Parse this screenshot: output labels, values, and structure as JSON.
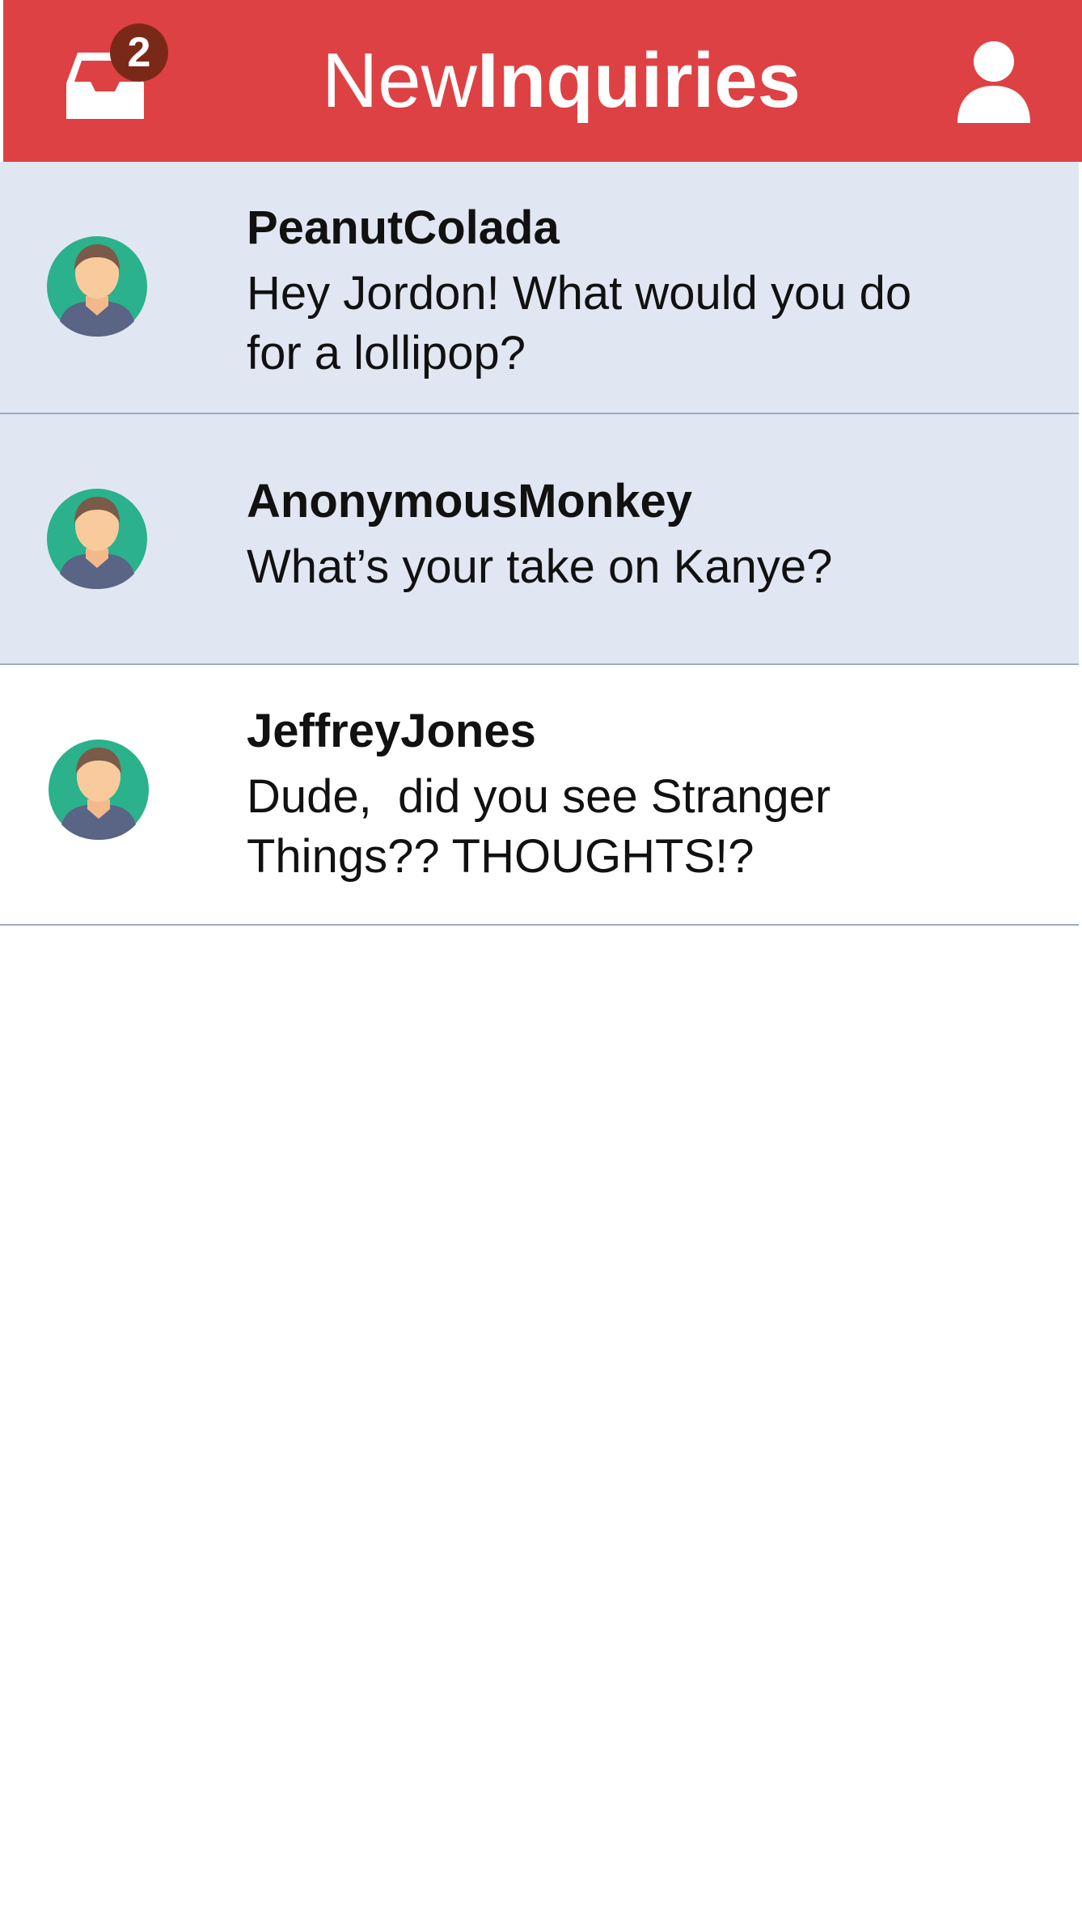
{
  "header": {
    "title_light": "New",
    "title_bold": "Inquiries",
    "inbox_icon": "inbox-tray-icon",
    "inbox_badge_count": "2",
    "profile_icon": "user-icon",
    "background_color": "#de4143",
    "badge_color": "#7a2918"
  },
  "inquiries": [
    {
      "sender": "PeanutColada",
      "message": "Hey Jordon! What would you do for a lollipop?",
      "avatar_icon": "user-avatar-icon",
      "unread": true
    },
    {
      "sender": "AnonymousMonkey",
      "message": "What’s your take on Kanye?",
      "avatar_icon": "user-avatar-icon",
      "unread": true
    },
    {
      "sender": "JeffreyJones",
      "message": "Dude,  did you see Stranger Things?? THOUGHTS!?",
      "avatar_icon": "user-avatar-icon",
      "unread": false
    }
  ],
  "colors": {
    "unread_row": "#e0e7f2",
    "read_row": "#ffffff",
    "divider": "#9cabc6",
    "avatar_bg": "#2bb18c",
    "avatar_skin": "#f9cb9c",
    "avatar_hair": "#7a5a48",
    "avatar_shirt": "#5a6484"
  }
}
